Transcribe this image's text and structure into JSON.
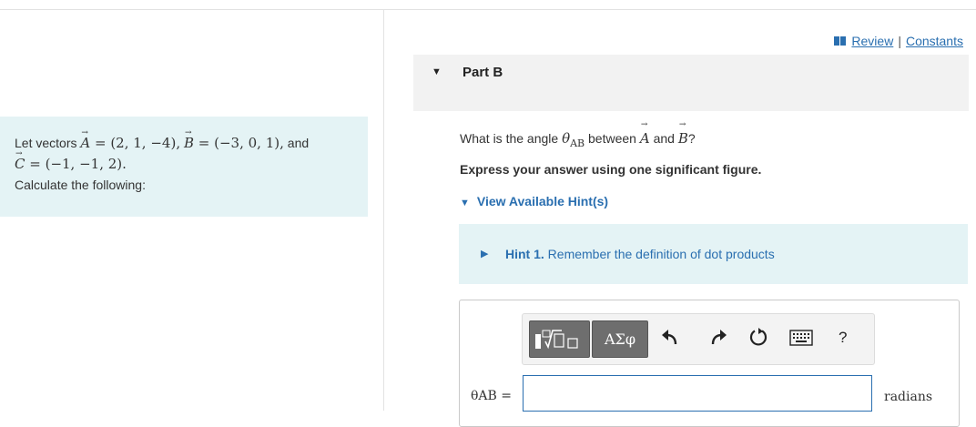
{
  "problem": {
    "line1_prefix": "Let vectors",
    "vec_a_name": "A",
    "vec_a_value": "(2, 1, −4)",
    "vec_b_name": "B",
    "vec_b_value": "(−3, 0, 1)",
    "and_text": "and",
    "vec_c_name": "C",
    "vec_c_value": "(−1, −1, 2)",
    "line3": "Calculate the following:"
  },
  "review": {
    "review_label": "Review",
    "separator": "|",
    "constants_label": "Constants"
  },
  "part": {
    "title": "Part B"
  },
  "question": {
    "prefix": "What is the angle",
    "theta": "θ",
    "subscript": "AB",
    "between": "between",
    "vec_a": "A",
    "and": "and",
    "vec_b": "B",
    "suffix": "?"
  },
  "instruction": "Express your answer using one significant figure.",
  "hints": {
    "toggle_label": "View Available Hint(s)"
  },
  "hint1": {
    "number": "Hint 1.",
    "text": "Remember the definition of dot products"
  },
  "toolbar": {
    "greek_label": "ΑΣφ",
    "help_label": "?"
  },
  "answer": {
    "label": "θAB =",
    "value": "",
    "unit": "radians"
  },
  "colors": {
    "link": "#2a6fb0",
    "panel": "#e4f3f5",
    "header": "#f2f2f2",
    "button": "#6e6e6e"
  }
}
